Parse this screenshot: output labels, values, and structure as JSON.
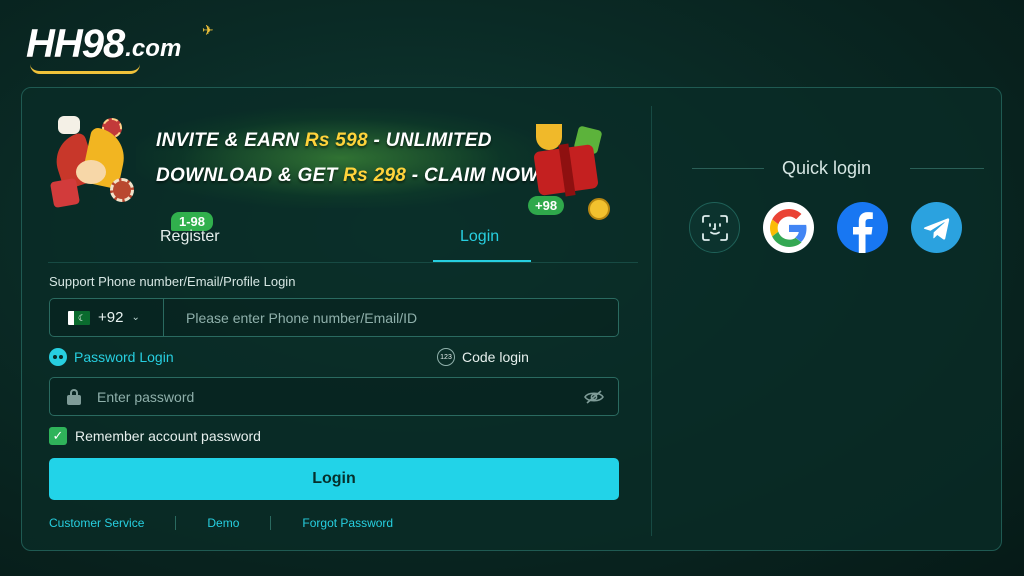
{
  "logo": {
    "main": "HH98",
    "suffix": ".com"
  },
  "banner": {
    "line1_prefix": "INVITE & EARN ",
    "line1_highlight": "Rs 598",
    "line1_suffix": " - UNLIMITED",
    "line2_prefix": "DOWNLOAD & GET ",
    "line2_highlight": "Rs 298",
    "line2_suffix": " - CLAIM NOW",
    "gift_badge": "+98"
  },
  "tabs": {
    "register_badge": "1-98",
    "register": "Register",
    "login": "Login",
    "active": "login"
  },
  "form": {
    "support_label": "Support Phone number/Email/Profile Login",
    "country_code": "+92",
    "phone_placeholder": "Please enter Phone number/Email/ID",
    "password_login_label": "Password Login",
    "code_login_label": "Code login",
    "code_icon_text": "123",
    "password_placeholder": "Enter password",
    "remember_label": "Remember account password",
    "remember_checked": true,
    "login_button": "Login"
  },
  "footer_links": [
    "Customer Service",
    "Demo",
    "Forgot Password"
  ],
  "quick_login": {
    "title": "Quick login",
    "providers": [
      "face-id-icon",
      "google-icon",
      "facebook-icon",
      "telegram-icon"
    ]
  },
  "colors": {
    "accent": "#22d3e8",
    "background": "#0a2a25",
    "badge_green": "#31b04d",
    "highlight_yellow": "#ffd33b"
  }
}
